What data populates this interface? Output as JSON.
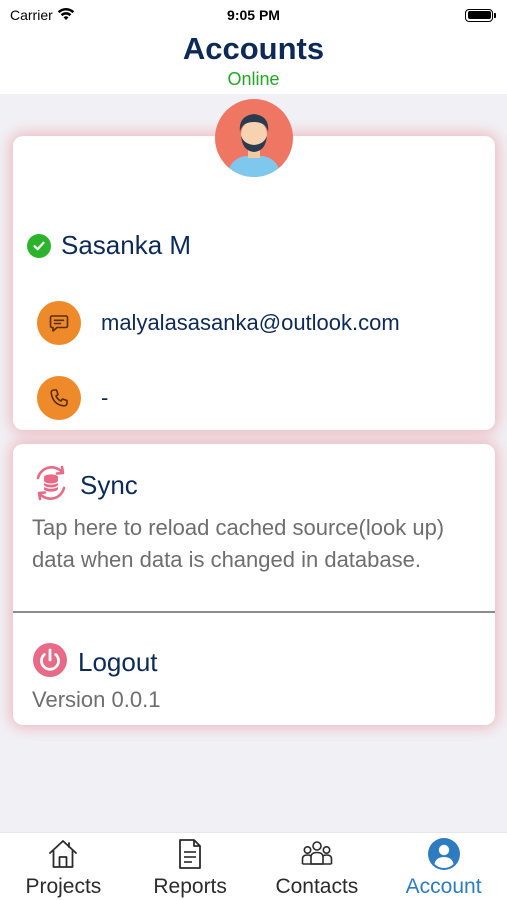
{
  "status_bar": {
    "carrier": "Carrier",
    "time": "9:05 PM"
  },
  "header": {
    "title": "Accounts",
    "status": "Online",
    "status_color": "#23a722"
  },
  "profile": {
    "name": "Sasanka M",
    "email": "malyalasasanka@outlook.com",
    "phone": "-"
  },
  "sync": {
    "title": "Sync",
    "description": "Tap here to reload cached source(look up) data when data is changed in database."
  },
  "logout": {
    "title": "Logout",
    "version": "Version 0.0.1"
  },
  "tabs": [
    {
      "label": "Projects",
      "icon": "home-icon",
      "active": false
    },
    {
      "label": "Reports",
      "icon": "document-icon",
      "active": false
    },
    {
      "label": "Contacts",
      "icon": "group-icon",
      "active": false
    },
    {
      "label": "Account",
      "icon": "account-icon",
      "active": true
    }
  ],
  "colors": {
    "accent": "#2e7cc0",
    "orange": "#ee8a2a",
    "pink": "#e86a86",
    "navy": "#0d2a57"
  }
}
